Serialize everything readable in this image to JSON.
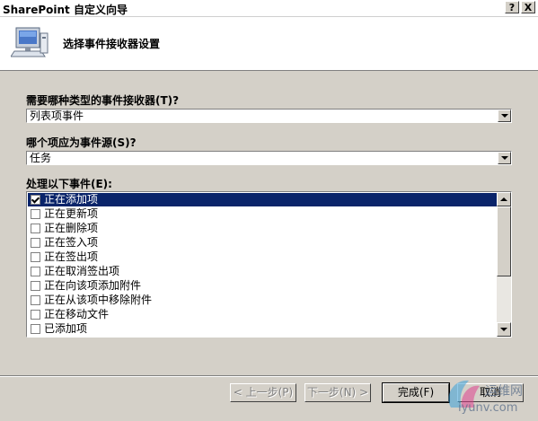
{
  "window": {
    "title": "SharePoint 自定义向导",
    "help_button": "?",
    "close_button": "X"
  },
  "header": {
    "title": "选择事件接收器设置",
    "icon": "computer-monitor-icon"
  },
  "receiver_type": {
    "label": "需要哪种类型的事件接收器(T)?",
    "value": "列表项事件"
  },
  "event_source": {
    "label": "哪个项应为事件源(S)?",
    "value": "任务"
  },
  "events": {
    "label": "处理以下事件(E):",
    "items": [
      {
        "label": "正在添加项",
        "checked": true,
        "selected": true
      },
      {
        "label": "正在更新项",
        "checked": false,
        "selected": false
      },
      {
        "label": "正在删除项",
        "checked": false,
        "selected": false
      },
      {
        "label": "正在签入项",
        "checked": false,
        "selected": false
      },
      {
        "label": "正在签出项",
        "checked": false,
        "selected": false
      },
      {
        "label": "正在取消签出项",
        "checked": false,
        "selected": false
      },
      {
        "label": "正在向该项添加附件",
        "checked": false,
        "selected": false
      },
      {
        "label": "正在从该项中移除附件",
        "checked": false,
        "selected": false
      },
      {
        "label": "正在移动文件",
        "checked": false,
        "selected": false
      },
      {
        "label": "已添加项",
        "checked": false,
        "selected": false
      }
    ]
  },
  "buttons": {
    "prev": "< 上一步(P)",
    "next": "下一步(N) >",
    "finish": "完成(F)",
    "cancel": "取消"
  },
  "watermark": {
    "text1": "运维网",
    "text2": "iyunv.com"
  },
  "colors": {
    "selection": "#0a246a",
    "face": "#d4d0c8"
  }
}
